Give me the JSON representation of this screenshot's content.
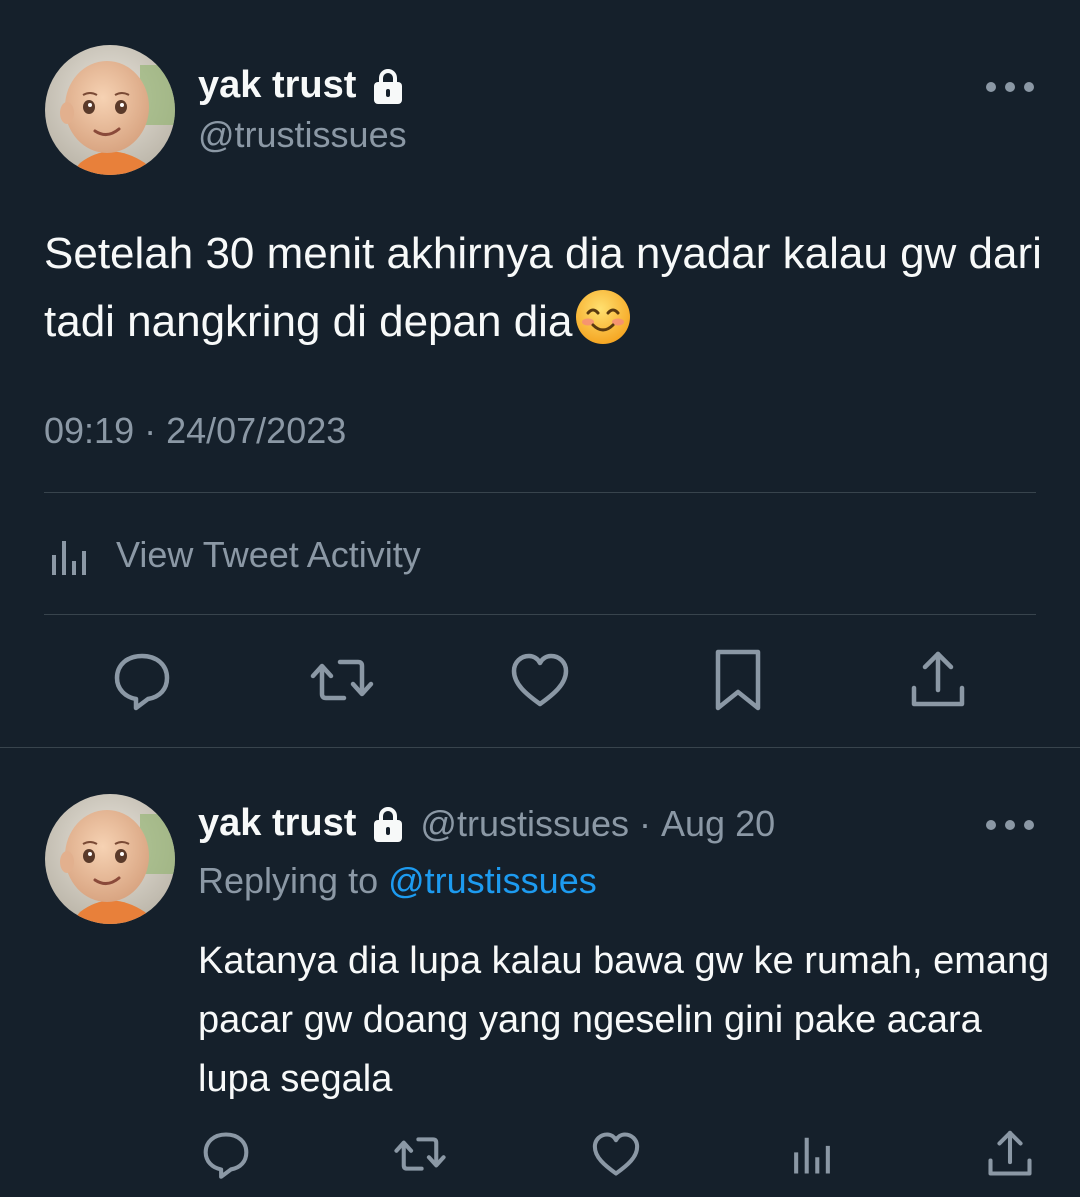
{
  "main_tweet": {
    "display_name": "yak trust",
    "handle": "@trustissues",
    "text": "Setelah 30 menit akhirnya dia nyadar kalau gw dari tadi nangkring di depan dia",
    "emoji": "smiling-face-with-smiling-eyes",
    "timestamp": "09:19 · 24/07/2023",
    "activity_label": "View Tweet Activity",
    "actions": [
      "reply-icon",
      "retweet-icon",
      "like-icon",
      "bookmark-icon",
      "share-icon"
    ]
  },
  "reply_tweet": {
    "display_name": "yak trust",
    "handle": "@trustissues",
    "separator": "·",
    "date": "Aug 20",
    "replying_prefix": "Replying to",
    "replying_handle": "@trustissues",
    "text": "Katanya dia lupa kalau bawa gw ke rumah, emang pacar gw doang yang ngeselin gini pake acara lupa segala",
    "actions": [
      "reply-icon",
      "retweet-icon",
      "like-icon",
      "views-icon",
      "share-icon"
    ]
  },
  "colors": {
    "background": "#15202b",
    "text_primary": "#f7f9f9",
    "text_secondary": "#8b98a5",
    "link": "#1d9bf0",
    "divider": "#38444d"
  }
}
